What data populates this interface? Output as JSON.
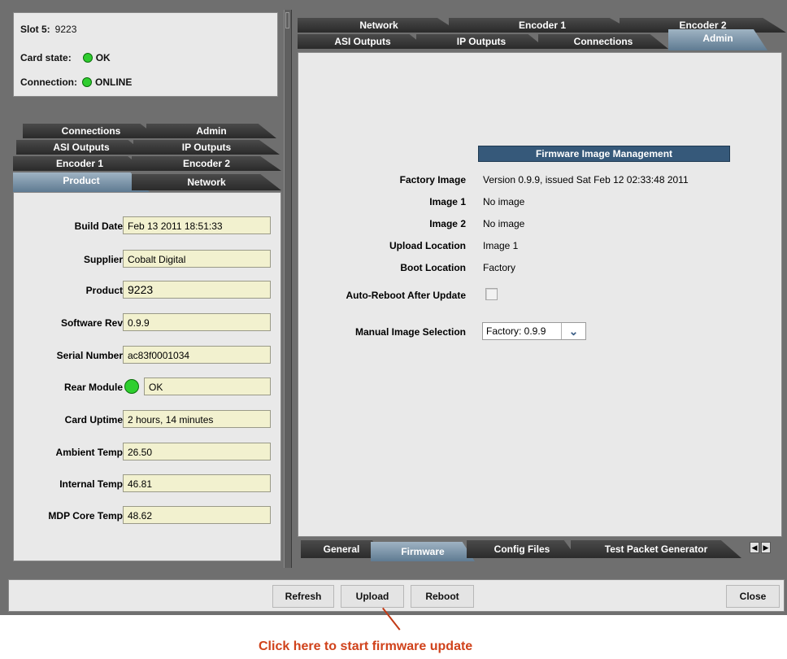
{
  "status": {
    "slot_label": "Slot 5:",
    "slot_value": "9223",
    "card_state_label": "Card state:",
    "card_state_value": "OK",
    "connection_label": "Connection:",
    "connection_value": "ONLINE"
  },
  "left_tabs": {
    "row1": [
      "Connections",
      "Admin"
    ],
    "row2": [
      "ASI Outputs",
      "IP Outputs"
    ],
    "row3": [
      "Encoder 1",
      "Encoder 2"
    ],
    "row4": [
      "Product",
      "Network"
    ],
    "active": "Product"
  },
  "product": {
    "build_date_label": "Build Date",
    "build_date": "Feb 13 2011 18:51:33",
    "supplier_label": "Supplier",
    "supplier": "Cobalt Digital",
    "product_label": "Product",
    "product": "9223",
    "software_rev_label": "Software Rev",
    "software_rev": "0.9.9",
    "serial_label": "Serial Number",
    "serial": "ac83f0001034",
    "rear_module_label": "Rear Module",
    "rear_module": "OK",
    "uptime_label": "Card Uptime",
    "uptime": "2 hours, 14 minutes",
    "ambient_label": "Ambient Temp",
    "ambient": "26.50",
    "internal_label": "Internal Temp",
    "internal": "46.81",
    "mdp_label": "MDP Core Temp",
    "mdp": "48.62"
  },
  "right_tabs": {
    "row1": [
      "Network",
      "Encoder 1",
      "Encoder 2"
    ],
    "row2": [
      "ASI Outputs",
      "IP Outputs",
      "Connections",
      "Admin"
    ],
    "active": "Admin"
  },
  "firmware": {
    "section_title": "Firmware Image Management",
    "factory_label": "Factory Image",
    "factory_value": "Version 0.9.9, issued Sat Feb 12 02:33:48 2011",
    "image1_label": "Image 1",
    "image1_value": "No image",
    "image2_label": "Image 2",
    "image2_value": "No image",
    "upload_loc_label": "Upload Location",
    "upload_loc_value": "Image 1",
    "boot_loc_label": "Boot Location",
    "boot_loc_value": "Factory",
    "autoreboot_label": "Auto-Reboot After Update",
    "autoreboot_checked": false,
    "manual_label": "Manual Image Selection",
    "manual_value": "Factory: 0.9.9"
  },
  "bottom_tabs": {
    "items": [
      "General",
      "Firmware",
      "Config Files",
      "Test Packet Generator"
    ],
    "active": "Firmware"
  },
  "buttons": {
    "refresh": "Refresh",
    "upload": "Upload",
    "reboot": "Reboot",
    "close": "Close"
  },
  "callout": "Click here to start firmware update",
  "colors": {
    "led_green": "#2fcd2f",
    "section_header": "#36597a",
    "field_bg": "#f2f1cf",
    "callout": "#d0421b"
  }
}
